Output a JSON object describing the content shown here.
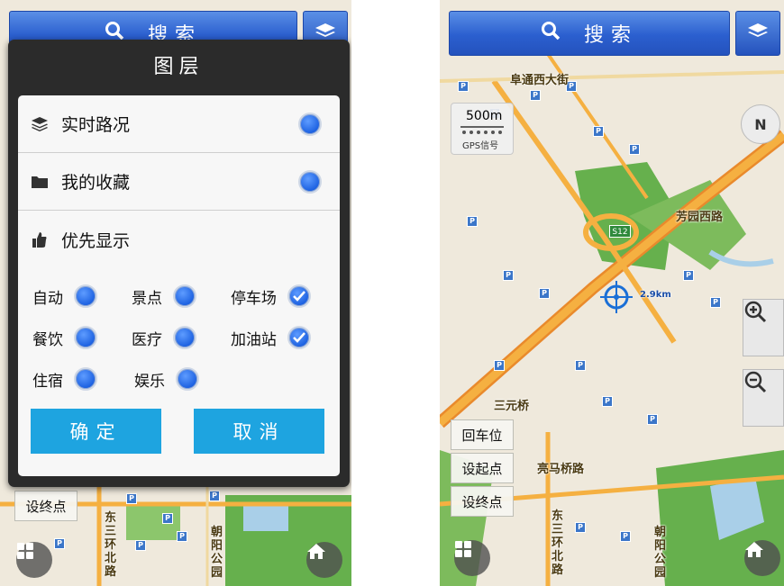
{
  "search": {
    "label": "搜索"
  },
  "dialog": {
    "title": "图层",
    "rows": [
      {
        "label": "实时路况",
        "icon": "layers-icon"
      },
      {
        "label": "我的收藏",
        "icon": "folder-icon"
      },
      {
        "label": "优先显示",
        "icon": "thumbs-up-icon"
      }
    ],
    "priority": [
      {
        "label": "自动",
        "checked": false
      },
      {
        "label": "景点",
        "checked": false
      },
      {
        "label": "停车场",
        "checked": true
      },
      {
        "label": "餐饮",
        "checked": false
      },
      {
        "label": "医疗",
        "checked": false
      },
      {
        "label": "加油站",
        "checked": true
      },
      {
        "label": "住宿",
        "checked": false
      },
      {
        "label": "娱乐",
        "checked": false
      }
    ],
    "confirm": "确定",
    "cancel": "取消"
  },
  "map": {
    "scale": "500m",
    "gps": "GPS信号",
    "distance": "2.9km",
    "compass": "N",
    "road_labels": [
      "阜通西大街",
      "芳园西路",
      "三元桥",
      "亮马桥路",
      "东三环北路",
      "朝阳公园"
    ],
    "shield": "S12"
  },
  "buttons": {
    "back_to_car": "回车位",
    "set_start": "设起点",
    "set_end": "设终点"
  },
  "colors": {
    "blue": "#2b5fcf",
    "accent": "#1ea4e0",
    "road": "#f5b041",
    "green": "#66b04d",
    "water": "#a9cfe8"
  }
}
